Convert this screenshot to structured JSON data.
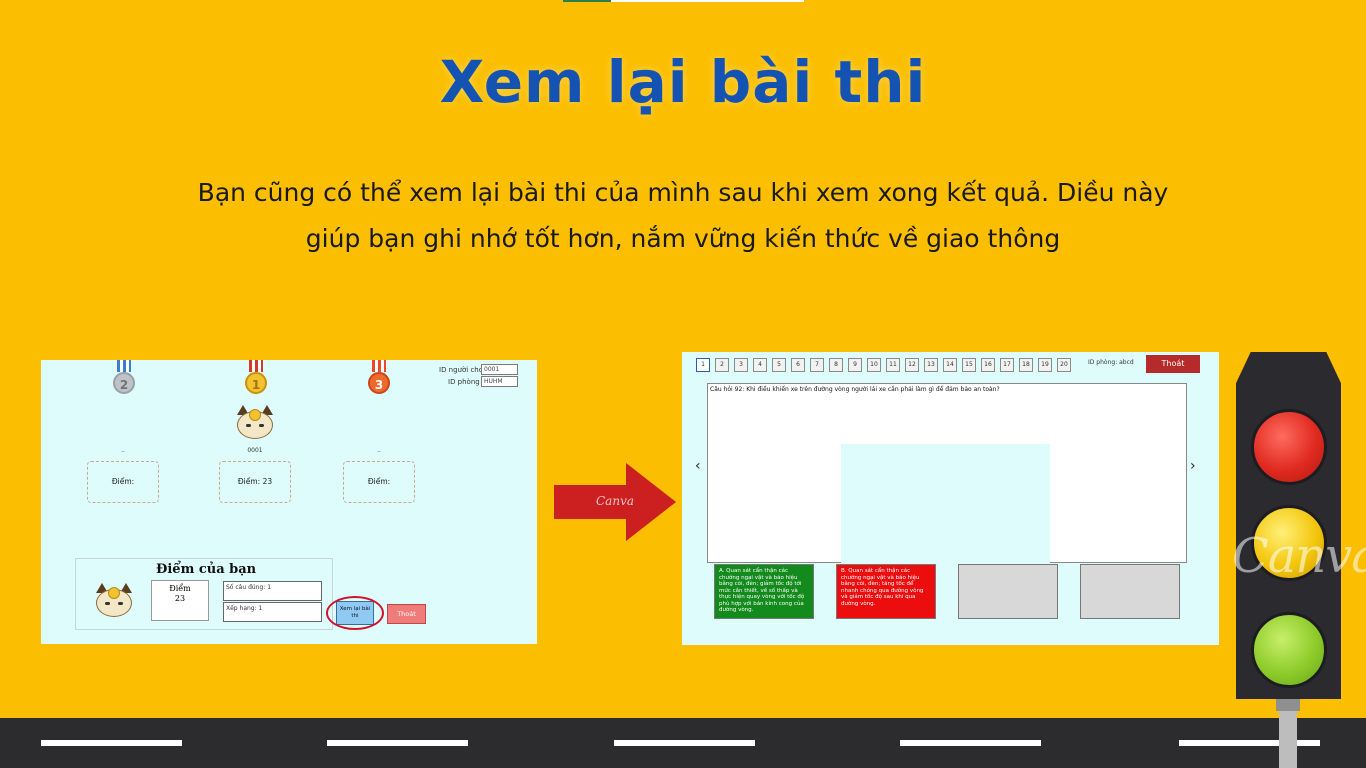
{
  "title": "Xem lại bài thi",
  "description": {
    "line1": "Bạn cũng có thể xem lại bài thi của mình sau khi xem xong kết quả. Diều này",
    "line2": "giúp bạn ghi nhớ tốt hơn, nắm vững kiến thức về giao thông"
  },
  "left_screen": {
    "id_nguoi_choi_label": "ID người chơi",
    "id_nguoi_choi_value": "0001",
    "id_phong_label": "ID phòng",
    "id_phong_value": "HUHM",
    "medals": [
      "2",
      "1",
      "3"
    ],
    "slots": [
      {
        "name": "..",
        "score": "Điểm:"
      },
      {
        "name": "0001",
        "score": "Điểm: 23"
      },
      {
        "name": "..",
        "score": "Điểm:"
      }
    ],
    "result_title": "Điểm của bạn",
    "score_label": "Điểm",
    "score_value": "23",
    "correct_count": "Số câu đúng: 1",
    "rank": "Xếp hạng: 1",
    "review_button": "Xem lại bài thi",
    "exit_button": "Thoát"
  },
  "arrow_label": "Canva",
  "right_screen": {
    "question_numbers": [
      "1",
      "2",
      "3",
      "4",
      "5",
      "6",
      "7",
      "8",
      "9",
      "10",
      "11",
      "12",
      "13",
      "14",
      "15",
      "16",
      "17",
      "18",
      "19",
      "20"
    ],
    "active_question": "1",
    "room_id": "ID phòng: abcd",
    "quit_button": "Thoát",
    "question_text": "Câu hỏi 92: Khi điều khiển xe trên đường vòng người lái xe cần phải làm gì để đảm bảo an toàn?",
    "answers": [
      {
        "text": "A. Quan sát cẩn thận các chướng ngại vật và báo hiệu bằng còi, đèn; giảm tốc độ tới mức cần thiết, về số thấp và thực hiện quay vòng với tốc độ phù hợp với bán kính cong của đường vòng.",
        "color": "#138a1c"
      },
      {
        "text": "B. Quan sát cẩn thận các chướng ngại vật và báo hiệu bằng còi, đèn; tăng tốc để nhanh chóng qua đường vòng và giảm tốc độ sau khi qua đường vòng.",
        "color": "#ec0e0e"
      },
      {
        "text": "",
        "color": "#d8d8d8"
      },
      {
        "text": "",
        "color": "#d8d8d8"
      }
    ]
  },
  "watermark": "Canva",
  "colors": {
    "background": "#FBBE00",
    "title": "#1553B2",
    "road": "#2c2c2e",
    "arrow": "#CC1F1F"
  }
}
